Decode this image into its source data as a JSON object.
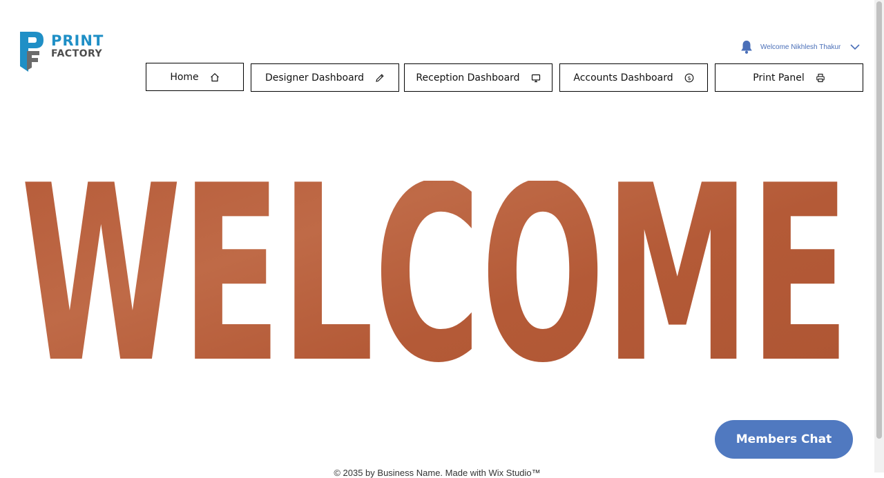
{
  "logo": {
    "line1": "PRINT",
    "line2": "FACTORY"
  },
  "user": {
    "welcome_text": "Welcome Nikhlesh Thakur"
  },
  "nav": [
    {
      "label": "Home",
      "icon": "home-icon"
    },
    {
      "label": "Designer Dashboard",
      "icon": "pencil-icon"
    },
    {
      "label": "Reception Dashboard",
      "icon": "monitor-icon"
    },
    {
      "label": "Accounts Dashboard",
      "icon": "dollar-icon"
    },
    {
      "label": "Print Panel",
      "icon": "printer-icon"
    }
  ],
  "hero": {
    "text": "WELCOME",
    "color": "#b9623f"
  },
  "chat": {
    "label": "Members Chat",
    "color": "#5079c0"
  },
  "footer": {
    "text": "© 2035 by Business Name. Made with Wix Studio™"
  }
}
